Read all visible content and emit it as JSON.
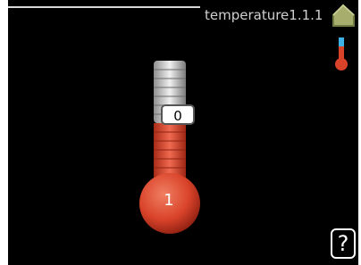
{
  "header": {
    "title": "temperature1.1.1",
    "home_icon": "home-icon"
  },
  "thermometer": {
    "value": "0",
    "bulb_label": "1",
    "colors": {
      "fill": "#d9432a",
      "empty": "#c9c9c9"
    }
  },
  "help": {
    "label": "?"
  }
}
